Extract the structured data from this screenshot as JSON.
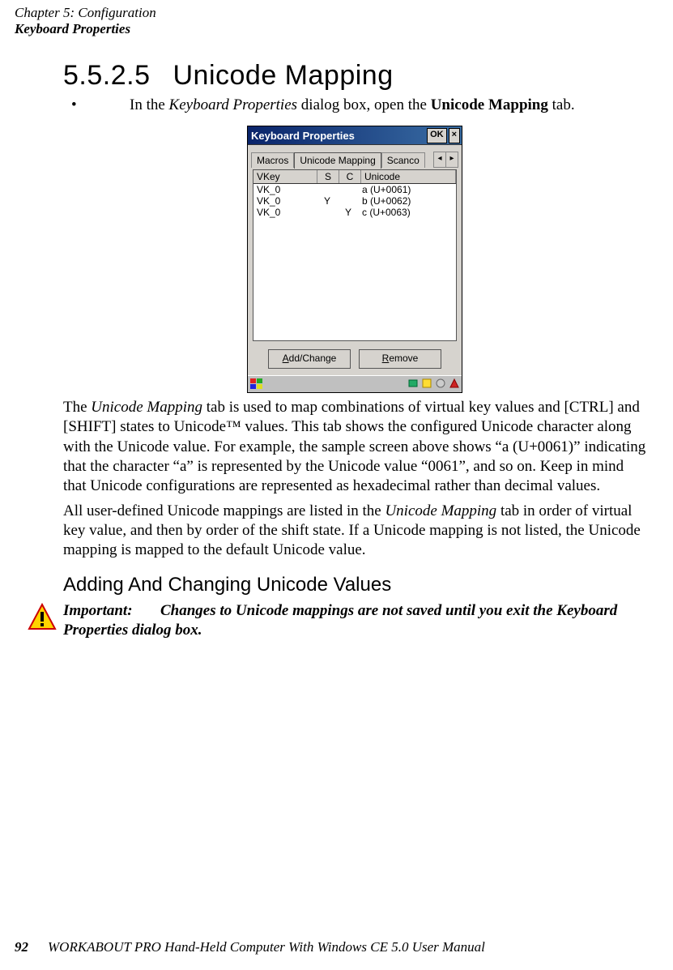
{
  "header": {
    "chapter": "Chapter 5: Configuration",
    "section": "Keyboard Properties"
  },
  "heading": {
    "number": "5.5.2.5",
    "title": "Unicode Mapping"
  },
  "bullet": {
    "prefix": "In the ",
    "ital": "Keyboard Properties",
    "mid": " dialog box, open the ",
    "bold": "Unicode Mapping",
    "suffix": " tab."
  },
  "dialog": {
    "title": "Keyboard Properties",
    "ok": "OK",
    "close": "×",
    "tabs": {
      "macros": "Macros",
      "unicode": "Unicode Mapping",
      "scan": "Scanco"
    },
    "arrows": {
      "left": "◂",
      "right": "▸"
    },
    "cols": {
      "vkey": "VKey",
      "s": "S",
      "c": "C",
      "uni": "Unicode"
    },
    "rows": [
      {
        "vkey": "VK_0",
        "s": "",
        "c": "",
        "uni": "a (U+0061)"
      },
      {
        "vkey": "VK_0",
        "s": "Y",
        "c": "",
        "uni": "b (U+0062)"
      },
      {
        "vkey": "VK_0",
        "s": "",
        "c": "Y",
        "uni": "c (U+0063)"
      }
    ],
    "buttons": {
      "add": "Add/Change",
      "remove": "Remove",
      "add_u": "A",
      "remove_u": "R",
      "add_rest": "dd/Change",
      "remove_rest": "emove"
    }
  },
  "para1": {
    "t1": "The ",
    "i1": "Unicode Mapping",
    "t2": " tab is used to map combinations of virtual key values and [CTRL] and [SHIFT] states to Unicode™ values. This tab shows the configured Unicode character along with the Unicode value. For example, the sample screen above shows “a (U+0061)” indicating that the character “a” is represented by the Unicode value “0061”, and so on. Keep in mind that Unicode configurations are represented as hexadecimal rather than decimal values."
  },
  "para2": {
    "t1": "All user-defined Unicode mappings are listed in the ",
    "i1": "Unicode Mapping",
    "t2": " tab in order of virtual key value, and then by order of the shift state. If a Unicode mapping is not listed, the Unicode mapping is mapped to the default Unicode value."
  },
  "subheading": "Adding And Changing Unicode Values",
  "important": {
    "label": "Important:",
    "text": "Changes to Unicode mappings are not saved until you exit the Keyboard Properties dialog box."
  },
  "footer": {
    "page": "92",
    "text": "WORKABOUT PRO Hand-Held Computer With Windows CE 5.0 User Manual"
  }
}
